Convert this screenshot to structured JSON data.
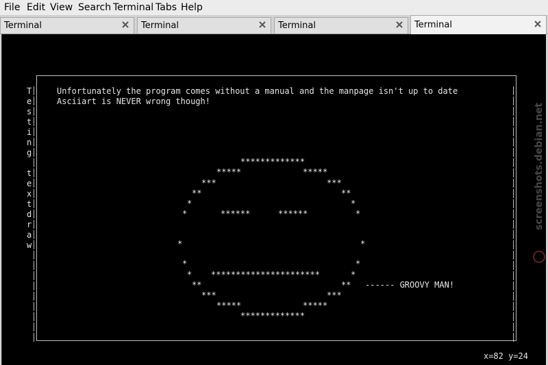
{
  "menu": {
    "items": [
      {
        "label": "File"
      },
      {
        "label": "Edit"
      },
      {
        "label": "View"
      },
      {
        "label": "Search"
      },
      {
        "label": "Terminal"
      },
      {
        "label": "Tabs"
      },
      {
        "label": "Help"
      }
    ]
  },
  "tabs": [
    {
      "label": "Terminal"
    },
    {
      "label": "Terminal"
    },
    {
      "label": "Terminal"
    },
    {
      "label": "Terminal"
    }
  ],
  "terminal": {
    "line1": "Unfortunately the program comes without a manual and the manpage isn't up to date",
    "line2": "Asciiart is NEVER wrong though!",
    "vertical_text": [
      "T",
      "e",
      "s",
      "t",
      "i",
      "n",
      "g",
      "",
      "t",
      "e",
      "x",
      "t",
      "d",
      "r",
      "a",
      "w"
    ],
    "face": {
      "r1": "*************",
      "r2l": "*****",
      "r2r": "*****",
      "r3l": "***",
      "r3r": "***",
      "r4l": "**",
      "r4r": "**",
      "r5l": "*",
      "r5r": "*",
      "r6l": "*",
      "eye_l": "******",
      "eye_r": "******",
      "r6r": "*",
      "r7l": "*",
      "r7r": "*",
      "r8l": "*",
      "r8r": "*",
      "r9l": "*",
      "mouth": "**********************",
      "r9r": "*",
      "r10l": "**",
      "r10r": "**",
      "caption": "------ GROOVY MAN!",
      "r11l": "***",
      "r11r": "***",
      "r12l": "*****",
      "r12r": "*****",
      "r13": "*************"
    },
    "status": "x=82 y=24",
    "watermark": "screenshots.debian.net"
  }
}
